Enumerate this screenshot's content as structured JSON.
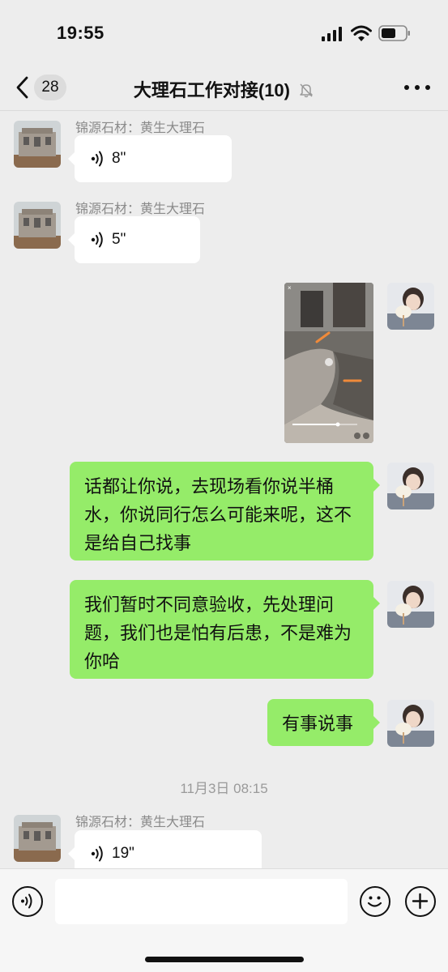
{
  "status_bar": {
    "time": "19:55"
  },
  "nav": {
    "unread_count": "28",
    "title": "大理石工作对接(10)"
  },
  "messages": {
    "m1": {
      "sender": "锦源石材：黄生大理石",
      "duration": "8\""
    },
    "m2": {
      "sender": "锦源石材：黄生大理石",
      "duration": "5\""
    },
    "m4": {
      "text": "话都让你说，去现场看你说半桶水，你说同行怎么可能来呢，这不是给自己找事"
    },
    "m5": {
      "text": "我们暂时不同意验收，先处理问题，我们也是怕有后患，不是难为你哈"
    },
    "m6": {
      "text": "有事说事"
    },
    "ts": {
      "text": "11月3日 08:15"
    },
    "m7": {
      "sender": "锦源石材：黄生大理石",
      "duration": "19\""
    }
  },
  "input": {
    "placeholder": ""
  },
  "colors": {
    "self_bubble": "#95ec69",
    "other_bubble": "#ffffff",
    "background": "#ededed",
    "annotation_arrow": "#f08a3a"
  },
  "icons": [
    "signal-icon",
    "wifi-icon",
    "battery-icon",
    "back-chevron-icon",
    "mute-bell-icon",
    "more-icon",
    "voice-wave-icon",
    "voice-input-icon",
    "emoji-icon",
    "add-icon"
  ]
}
